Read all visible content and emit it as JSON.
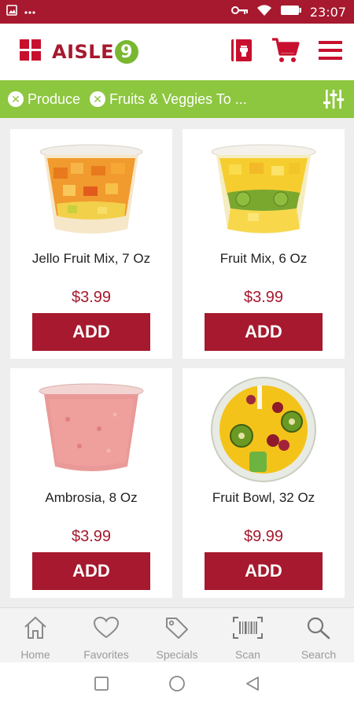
{
  "status_bar": {
    "time": "23:07",
    "left_icons": [
      "image-icon",
      "more-icon"
    ],
    "right_icons": [
      "key-icon",
      "wifi-icon",
      "battery-icon"
    ]
  },
  "header": {
    "logo_text": "AISLE",
    "logo_number": "9",
    "actions": [
      "store-icon",
      "cart-icon",
      "menu-icon"
    ]
  },
  "filters": {
    "chips": [
      {
        "label": "Produce"
      },
      {
        "label": "Fruits & Veggies To ..."
      }
    ],
    "settings_icon": "sliders-icon"
  },
  "products": [
    {
      "name": "Jello Fruit Mix, 7 Oz",
      "price": "$3.99",
      "button": "ADD"
    },
    {
      "name": "Fruit Mix, 6 Oz",
      "price": "$3.99",
      "button": "ADD"
    },
    {
      "name": "Ambrosia, 8 Oz",
      "price": "$3.99",
      "button": "ADD"
    },
    {
      "name": "Fruit Bowl, 32 Oz",
      "price": "$9.99",
      "button": "ADD"
    }
  ],
  "bottom_nav": [
    {
      "label": "Home",
      "icon": "home-icon"
    },
    {
      "label": "Favorites",
      "icon": "heart-icon"
    },
    {
      "label": "Specials",
      "icon": "tag-icon"
    },
    {
      "label": "Scan",
      "icon": "barcode-icon"
    },
    {
      "label": "Search",
      "icon": "search-icon"
    }
  ],
  "colors": {
    "brand_red": "#a6192e",
    "brand_green": "#8dc63f",
    "background": "#eeeeee"
  }
}
